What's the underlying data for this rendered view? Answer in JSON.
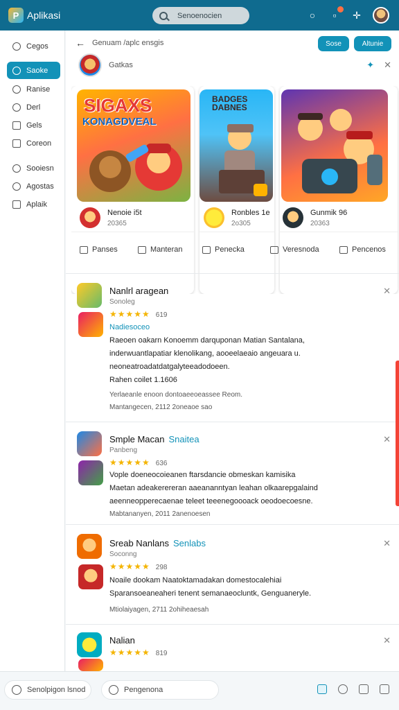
{
  "app": {
    "title": "Aplikasi"
  },
  "search": {
    "label": "Senoenocien"
  },
  "colors": {
    "accent": "#1292b8",
    "topbar": "#0f6b8f",
    "star": "#f4b400"
  },
  "sidebar": {
    "items": [
      {
        "label": "Cegos",
        "icon": "circle-icon"
      },
      {
        "label": "Saoke",
        "icon": "compass-icon",
        "active": true
      },
      {
        "label": "Ranise",
        "icon": "person-icon"
      },
      {
        "label": "Derl",
        "icon": "chat-icon"
      },
      {
        "label": "Gels",
        "icon": "grid-icon"
      },
      {
        "label": "Coreon",
        "icon": "settings-icon"
      },
      {
        "label": "Sooiesn",
        "icon": "people-icon"
      },
      {
        "label": "Agostas",
        "icon": "user-icon"
      },
      {
        "label": "Aplaik",
        "icon": "page-icon"
      }
    ]
  },
  "header": {
    "breadcrumb": "Genuam /aplc ensgis",
    "buttons": [
      "Sose",
      "Altunie"
    ],
    "profile_name": "Gatkas"
  },
  "cards": [
    {
      "image_title": "SIGAXS",
      "image_subtitle": "KONAGDVEAL",
      "title": "Nenoie i5t",
      "sub": "20365",
      "action": "Panses"
    },
    {
      "image_title": "BADGES DABNES",
      "title": "Ronbles 1e",
      "sub": "2o305",
      "action": "Manteran"
    },
    {
      "title": "Gunmik 96",
      "sub": "20363",
      "action": "Penecka"
    }
  ],
  "card_actions_extra": [
    "Veresnoda",
    "Pencenos"
  ],
  "posts": [
    {
      "title": "Nanlrl aragean",
      "tag": "",
      "sub": "Sonoleg",
      "stars": "★★★★★",
      "score": "619",
      "category": "Nadiesoceo",
      "body": [
        "Raeoen oakarn Konoemm darquponan Matian Santalana,",
        "inderwuantlapatiar klenolikang, aooeelaeaio angeuara u.",
        "neoneatroadatdatgalyteeadodoeen."
      ],
      "extra": "Rahen coilet 1.1606",
      "extra_line": "Yerlaeanle enoon dontoaeeoeassee Reom.",
      "meta": "Mantangecen, 2112 2oneaoe sao"
    },
    {
      "title": "Smple Macan",
      "tag": "Snaitea",
      "sub": "Panbeng",
      "stars": "★★★★★",
      "score": "636",
      "body": [
        "Vople doeneocoieanen ftarsdancie obmeskan kamisika",
        "Maetan adeakerereran aaeananntyan leahan olkaarepgalaind",
        "aeenneopperecaenae teleet teeenegoooack oeodoecoesne."
      ],
      "meta": "Mabtananyen, 2011 2anenoesen"
    },
    {
      "title": "Sreab Nanlans",
      "tag": "Senlabs",
      "sub": "Soconng",
      "stars": "★★★★★",
      "score": "298",
      "body": [
        "Noaile dookam Naatoktamadakan domestocalehiai",
        "Sparansoeaneaheri tenent semanaeocluntk, Genguaneryle."
      ],
      "meta": "Mtiolaiyagen, 2711 2ohiheaesah"
    },
    {
      "title": "Nalian",
      "tag": "",
      "sub": "",
      "stars": "★★★★★",
      "score": "819",
      "body": [],
      "meta": ""
    }
  ],
  "bottom": {
    "pill1": "Senolpigon lsnod",
    "pill2": "Pengenona"
  }
}
